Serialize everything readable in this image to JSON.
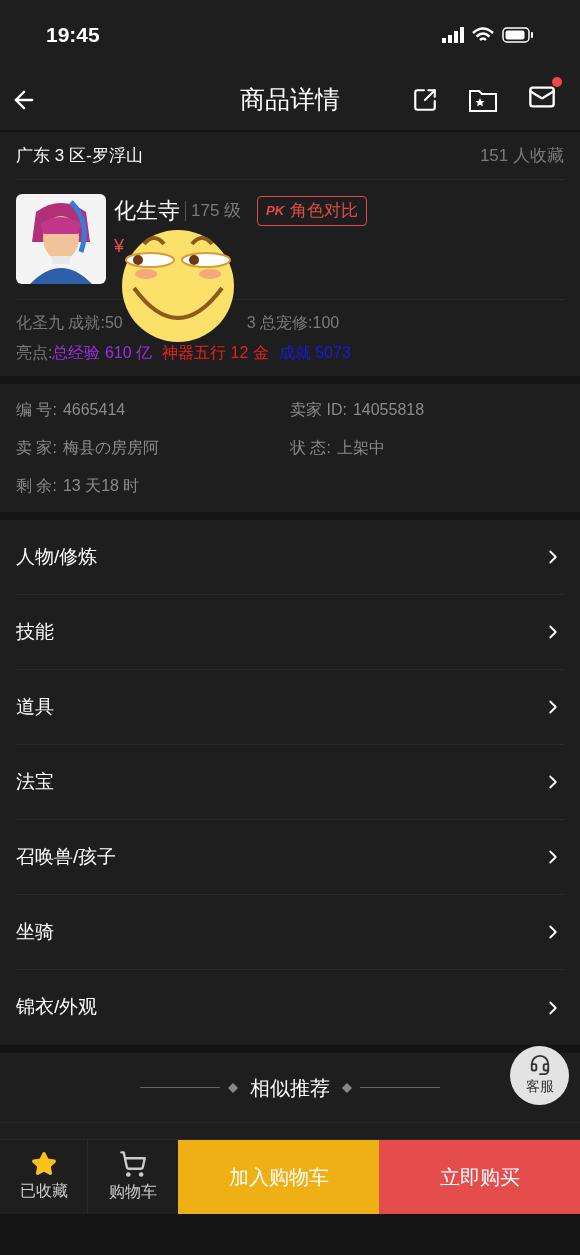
{
  "status_bar": {
    "time": "19:45"
  },
  "nav": {
    "title": "商品详情",
    "has_notification": true
  },
  "location": {
    "server": "广东 3 区-罗浮山",
    "favorites": "151 人收藏"
  },
  "role": {
    "school": "化生寺",
    "level": "175 级",
    "compare_button": "角色对比",
    "compare_icon": "PK",
    "price": "¥"
  },
  "stats": {
    "text_before": "化圣九 成就:50",
    "text_after": "3 总宠修:100"
  },
  "highlights": {
    "label": "亮点:",
    "items": [
      {
        "text": "总经验 610 亿",
        "color": "#9b2fe0"
      },
      {
        "text": "神器五行 12 金",
        "color": "#e3211f"
      },
      {
        "text": "成就 5073",
        "color": "#1a1ae0"
      }
    ]
  },
  "info": [
    {
      "label": "编 号:",
      "value": "4665414"
    },
    {
      "label": "卖家 ID:",
      "value": "14055818"
    },
    {
      "label": "卖 家:",
      "value": "梅县の房房阿"
    },
    {
      "label": "状 态:",
      "value": "上架中"
    },
    {
      "label": "剩 余:",
      "value": "13 天18 时"
    }
  ],
  "menu": [
    "人物/修炼",
    "技能",
    "道具",
    "法宝",
    "召唤兽/孩子",
    "坐骑",
    "锦衣/外观"
  ],
  "similar": {
    "title": "相似推荐"
  },
  "service_button": "客服",
  "bottom_bar": {
    "favorite": {
      "label": "已收藏",
      "selected": true
    },
    "cart": "购物车",
    "add_to_cart": "加入购物车",
    "buy_now": "立即购买"
  }
}
